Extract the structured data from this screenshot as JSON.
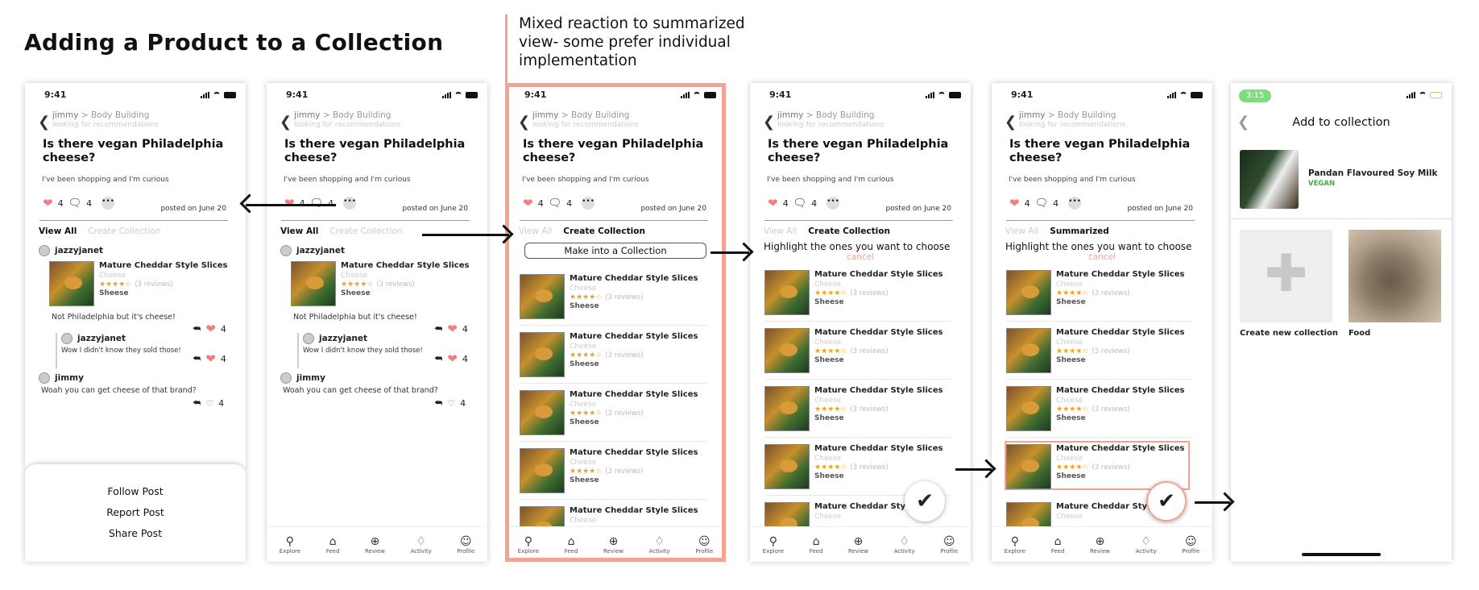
{
  "page_title": "Adding a Product to a Collection",
  "note": "Mixed reaction to summarized view- some prefer individual implementation",
  "post": {
    "time": "9:41",
    "user": "jimmy",
    "separator": ">",
    "community": "Body Building",
    "subtitle": "looking for recommendations",
    "title": "Is there vegan Philadelphia cheese?",
    "body": "I've been shopping and I'm curious",
    "likes": "4",
    "comments": "4",
    "more": "•••",
    "posted": "posted on June 20"
  },
  "tabs": {
    "view_all": "View All",
    "create_collection": "Create Collection",
    "summarized": "Summarized"
  },
  "product": {
    "name": "Mature Cheddar Style Slices",
    "category": "Cheese",
    "stars": "★★★★☆",
    "reviews": "(3 reviews)",
    "brand": "Sheese",
    "rating": 4.5
  },
  "thread": {
    "user1": "jazzyjanet",
    "comment1": "Not Philadelphia but it's cheese!",
    "reply_user": "jazzyjanet",
    "reply_text": "Wow I didn't know they sold those!",
    "user2": "jimmy",
    "comment2": "Woah you can get cheese of that brand?",
    "count": "4"
  },
  "sheet": {
    "follow": "Follow  Post",
    "report": "Report  Post",
    "share": "Share  Post"
  },
  "nav": {
    "explore": "Explore",
    "feed": "Feed",
    "review": "Review",
    "activity": "Activity",
    "profile": "Profile"
  },
  "collection": {
    "make_button": "Make into a Collection",
    "highlight": "Highlight the ones you want to choose",
    "cancel": "cancel",
    "check": "✔"
  },
  "add_to_collection": {
    "time": "3:15",
    "title": "Add to collection",
    "product_name": "Pandan Flavoured Soy Milk",
    "tag": "VEGAN",
    "new_collection": "Create new collection",
    "existing": "Food"
  },
  "icons": {
    "back": "chevron-left-icon",
    "heart": "heart-icon",
    "comment": "comment-icon",
    "reply": "reply-icon"
  },
  "colors": {
    "accent": "#f4a393",
    "star": "#f0a020",
    "vegan": "#3cb043",
    "time_badge": "#7ddc7b"
  }
}
